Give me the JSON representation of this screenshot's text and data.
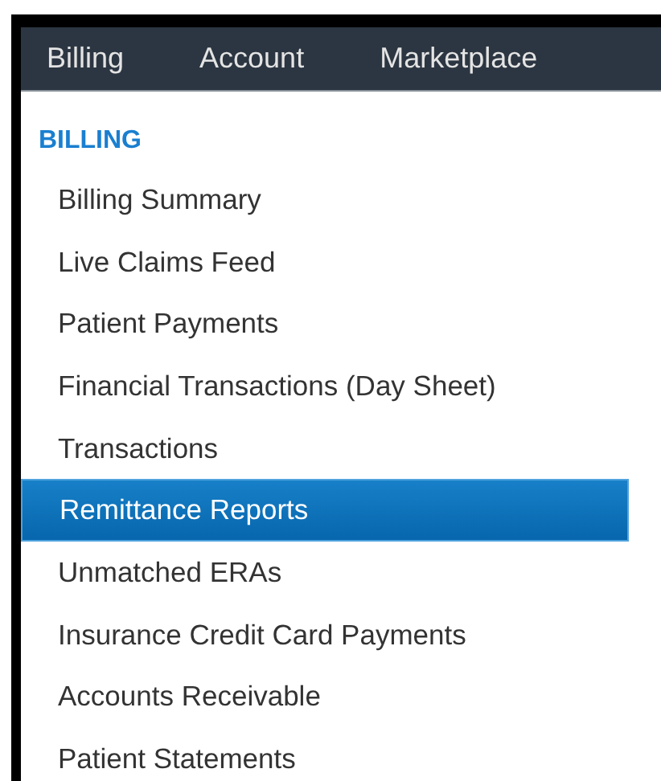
{
  "nav": [
    {
      "label": "Billing"
    },
    {
      "label": "Account"
    },
    {
      "label": "Marketplace"
    }
  ],
  "menu": {
    "heading": "BILLING",
    "items": [
      {
        "label": "Billing Summary",
        "selected": false
      },
      {
        "label": "Live Claims Feed",
        "selected": false
      },
      {
        "label": "Patient Payments",
        "selected": false
      },
      {
        "label": "Financial Transactions (Day Sheet)",
        "selected": false
      },
      {
        "label": "Transactions",
        "selected": false
      },
      {
        "label": "Remittance Reports",
        "selected": true
      },
      {
        "label": "Unmatched ERAs",
        "selected": false
      },
      {
        "label": "Insurance Credit Card Payments",
        "selected": false
      },
      {
        "label": "Accounts Receivable",
        "selected": false
      },
      {
        "label": "Patient Statements",
        "selected": false
      }
    ]
  }
}
